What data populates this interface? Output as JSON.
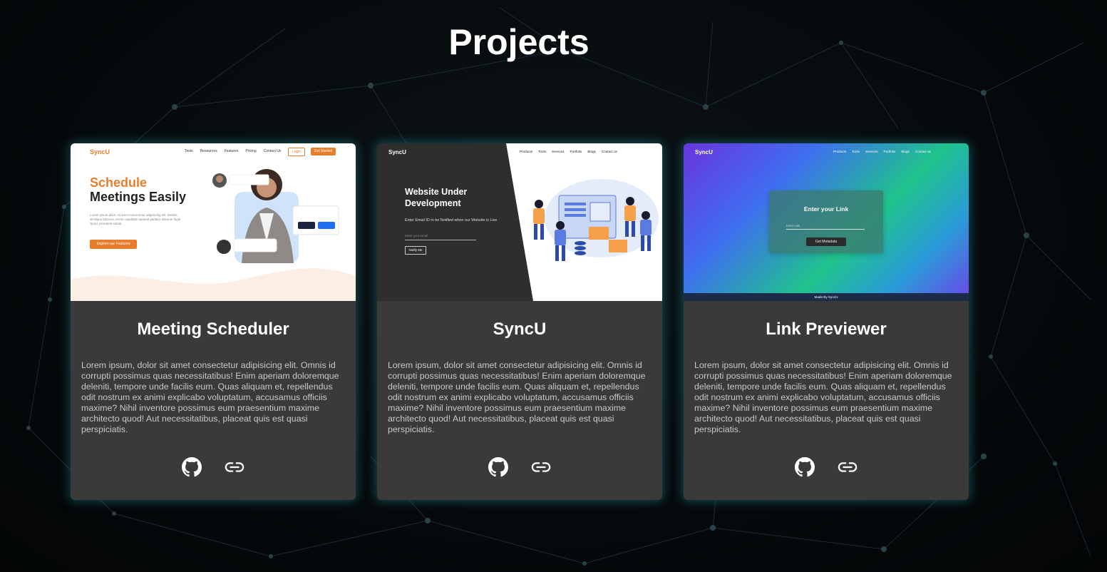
{
  "page": {
    "title": "Projects"
  },
  "colors": {
    "card_background": "#3a3a3a",
    "card_glow": "#28bec8",
    "accent_orange": "#e87d2b"
  },
  "projects": [
    {
      "title": "Meeting Scheduler",
      "description": "Lorem ipsum, dolor sit amet consectetur adipisicing elit. Omnis id corrupti possimus quas necessitatibus! Enim aperiam doloremque deleniti, tempore unde facilis eum. Quas aliquam et, repellendus odit nostrum ex animi explicabo voluptatum, accusamus officiis maxime? Nihil inventore possimus eum praesentium maxime architecto quod! Aut necessitatibus, placeat quis est quasi perspiciatis.",
      "icons": [
        "github-icon",
        "link-icon"
      ],
      "preview": {
        "logo": "SyncU",
        "nav": [
          "Tools",
          "Resources",
          "Features",
          "Pricing",
          "Contact Us"
        ],
        "login": "Login",
        "get_started": "Get Started",
        "headline_1": "Schedule",
        "headline_2": "Meetings Easily",
        "paragraph": "Lorem ipsum dolor, sit amet consectetur adipisicing elit. Debitis, similique laborum omnis cupiditate quaerat pariatur dolorum fugal Quod, provident soluta.",
        "cta": "Explore our Features"
      }
    },
    {
      "title": "SyncU",
      "description": "Lorem ipsum, dolor sit amet consectetur adipisicing elit. Omnis id corrupti possimus quas necessitatibus! Enim aperiam doloremque deleniti, tempore unde facilis eum. Quas aliquam et, repellendus odit nostrum ex animi explicabo voluptatum, accusamus officiis maxime? Nihil inventore possimus eum praesentium maxime architecto quod! Aut necessitatibus, placeat quis est quasi perspiciatis.",
      "icons": [
        "github-icon",
        "link-icon"
      ],
      "preview": {
        "logo": "SyncU",
        "nav": [
          "Products",
          "Tools",
          "Services",
          "Portfolio",
          "Blogs",
          "Contact us"
        ],
        "headline": "Website Under Development",
        "subtext": "Enter Email ID to be Notified when our Website is Live",
        "input_placeholder": "Enter your email",
        "button": "Notify Me"
      }
    },
    {
      "title": "Link Previewer",
      "description": "Lorem ipsum, dolor sit amet consectetur adipisicing elit. Omnis id corrupti possimus quas necessitatibus! Enim aperiam doloremque deleniti, tempore unde facilis eum. Quas aliquam et, repellendus odit nostrum ex animi explicabo voluptatum, accusamus officiis maxime? Nihil inventore possimus eum praesentium maxime architecto quod! Aut necessitatibus, placeat quis est quasi perspiciatis.",
      "icons": [
        "github-icon",
        "link-icon"
      ],
      "preview": {
        "logo": "SyncU",
        "nav": [
          "Products",
          "Tools",
          "Services",
          "Portfolio",
          "Blogs",
          "Contact us"
        ],
        "box_title": "Enter your Link",
        "input_placeholder": "Enter Link",
        "button": "Get Metadata",
        "footer": "Made By SyncU"
      }
    }
  ]
}
